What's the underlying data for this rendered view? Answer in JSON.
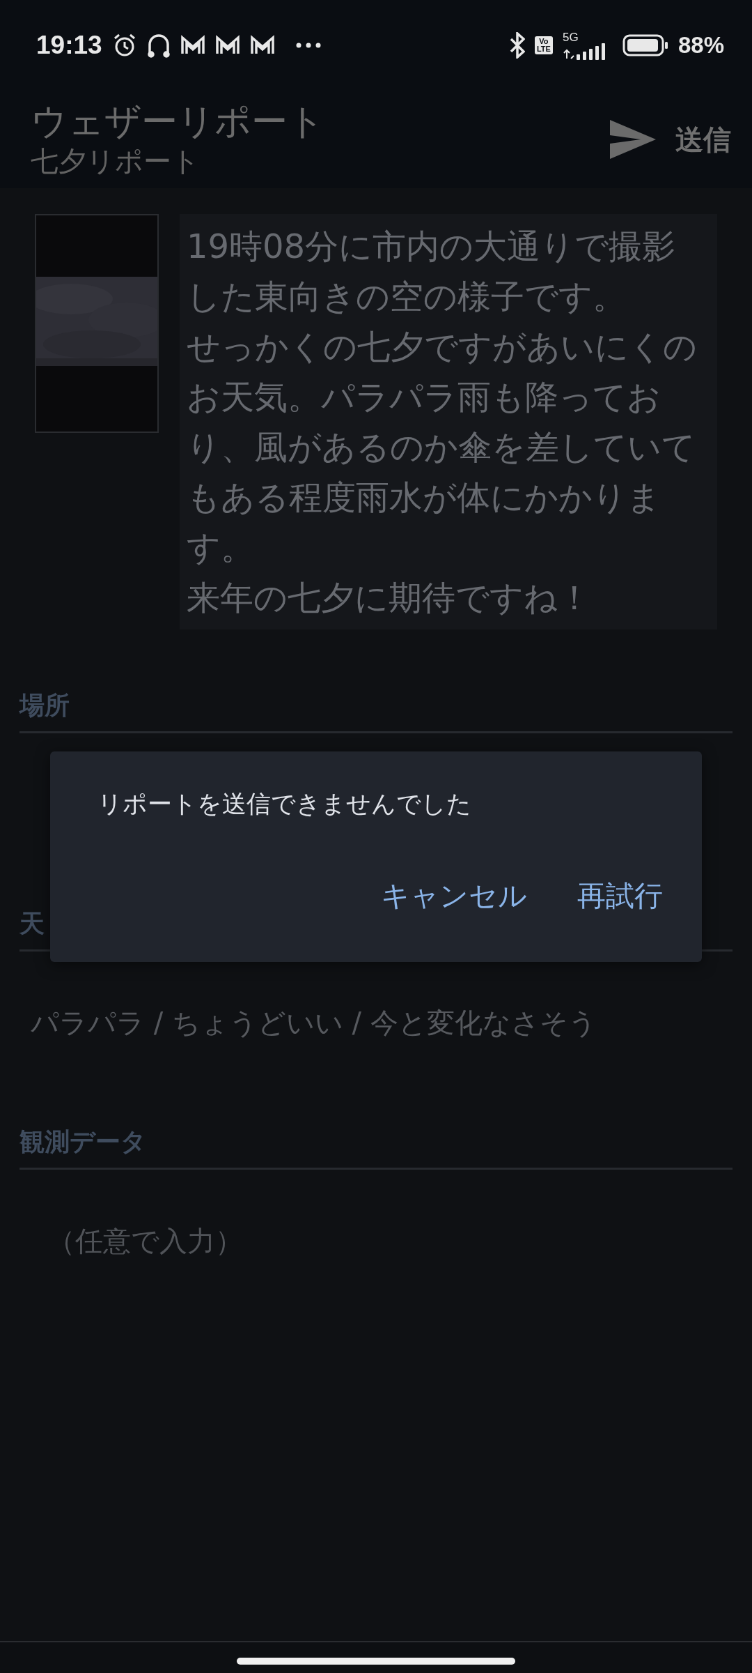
{
  "status_bar": {
    "time": "19:13",
    "network": "5G",
    "volte": [
      "Vo",
      "LTE"
    ],
    "battery": "88%"
  },
  "header": {
    "title": "ウェザーリポート",
    "subtitle": "七夕リポート",
    "send_label": "送信"
  },
  "report": {
    "description": [
      "19時08分に市内の大通りで撮影した東向きの空の様子です。",
      "せっかくの七夕ですがあいにくのお天気。パラパラ雨も降っており、風があるのか傘を差していてもある程度雨水が体にかかります。",
      "来年の七夕に期待ですね！"
    ]
  },
  "sections": [
    {
      "label": "場所"
    },
    {
      "label": "天",
      "value": "パラパラ / ちょうどいい / 今と変化なさそう"
    },
    {
      "label": "観測データ",
      "placeholder": "（任意で入力）"
    }
  ],
  "dialog": {
    "message": "リポートを送信できませんでした",
    "buttons": [
      "キャンセル",
      "再試行"
    ]
  }
}
